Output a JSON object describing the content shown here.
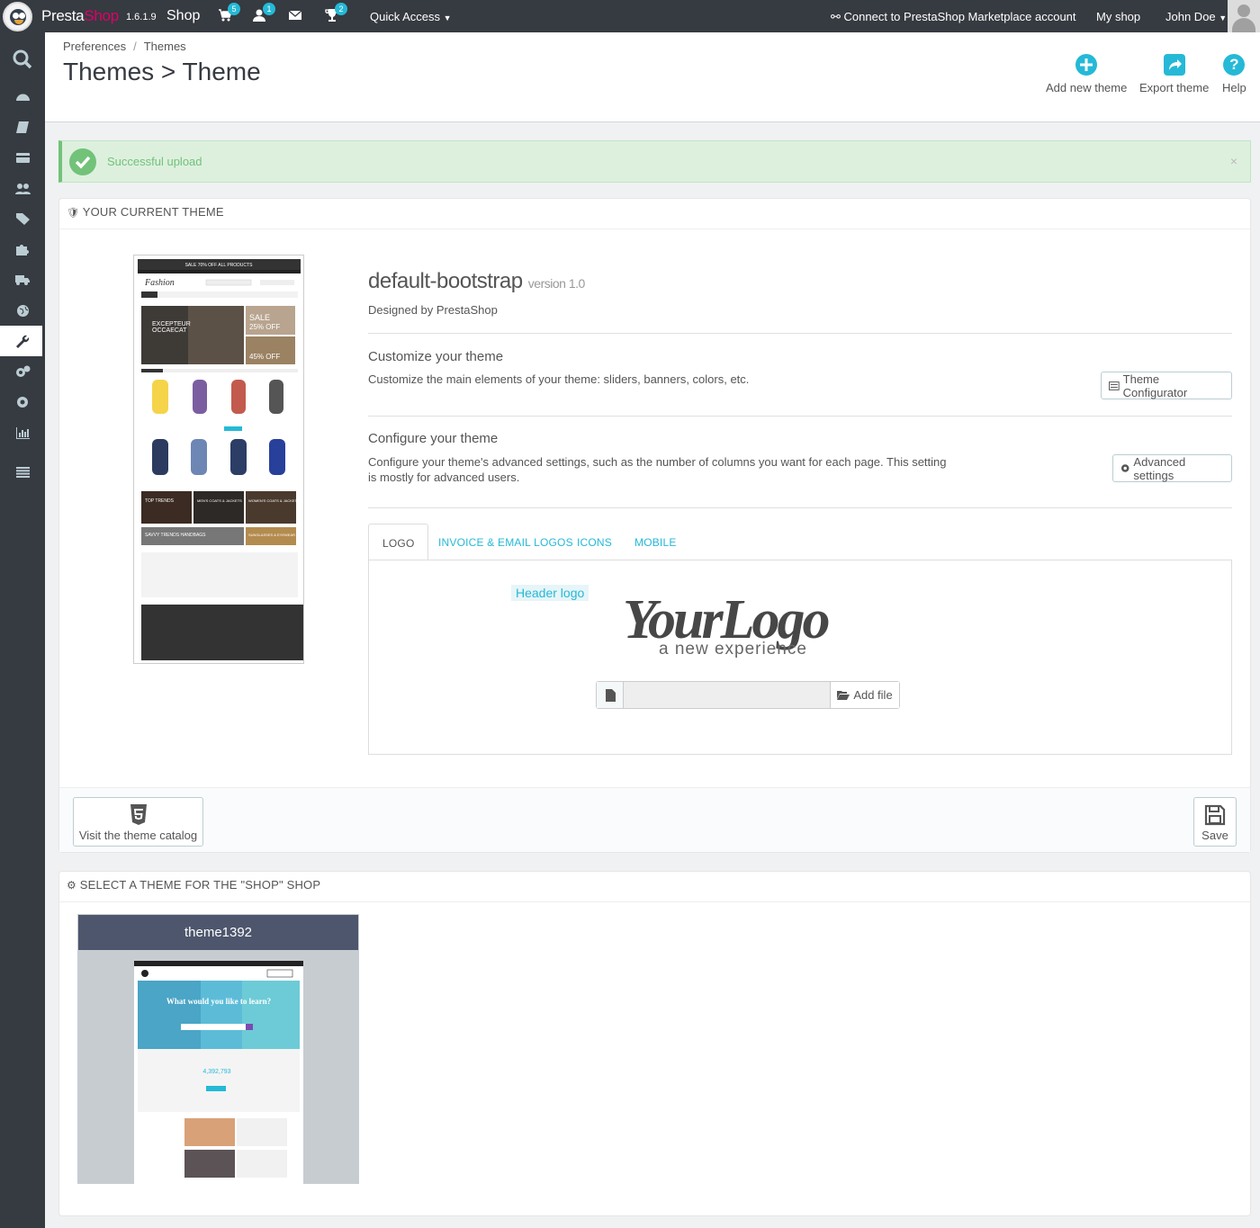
{
  "topbar": {
    "brand_1": "Presta",
    "brand_2": "Shop",
    "version": "1.6.1.9",
    "shop_name": "Shop",
    "orders_count": "5",
    "customers_count": "1",
    "messages_count": "2",
    "quick_access": "Quick Access",
    "marketplace": "Connect to PrestaShop Marketplace account",
    "my_shop": "My shop",
    "user": "John Doe"
  },
  "sidebar": {
    "items": [
      "search-icon",
      "dashboard-icon",
      "catalog-icon",
      "orders-icon",
      "customers-icon",
      "price-rules-icon",
      "modules-icon",
      "shipping-icon",
      "localization-icon",
      "preferences-icon",
      "advanced-parameters-icon",
      "administration-icon",
      "stats-icon",
      "collapse-menu-icon"
    ],
    "active": "preferences-icon"
  },
  "header": {
    "breadcrumb": [
      "Preferences",
      "Themes"
    ],
    "title": "Themes > Theme",
    "toolbar": {
      "add_theme": "Add new theme",
      "export_theme": "Export theme",
      "help": "Help"
    },
    "accent": "#25b9d7"
  },
  "alert": {
    "message": "Successful upload",
    "close": "×",
    "color": "#72c279"
  },
  "current_theme": {
    "panel_title": "YOUR CURRENT THEME",
    "name": "default-bootstrap",
    "version": "version 1.0",
    "designed_by": "Designed by PrestaShop",
    "customize": {
      "title": "Customize your theme",
      "desc": "Customize the main elements of your theme: sliders, banners, colors, etc.",
      "button": "Theme Configurator"
    },
    "configure": {
      "title": "Configure your theme",
      "desc": "Configure your theme's advanced settings, such as the number of columns you want for each page. This setting is mostly for advanced users.",
      "button": "Advanced settings"
    },
    "tabs": [
      "LOGO",
      "INVOICE & EMAIL LOGOS",
      "ICONS",
      "MOBILE"
    ],
    "active_tab": "LOGO",
    "logo": {
      "label": "Header logo",
      "logo_text_1": "YourLogo",
      "logo_text_2": "a new experience",
      "add_file": "Add file"
    },
    "thumbnail": {
      "banner": "SALE 70% OFF ALL PRODUCTS",
      "brand": "Fashion",
      "hero_1": "EXCEPTEUR",
      "hero_2": "OCCAECAT",
      "sale_1": "SALE",
      "sale_2": "25% OFF",
      "sale_3": "45% OFF",
      "block_1": "TOP TRENDS",
      "block_2": "MEN'S COATS & JACKETS",
      "block_3": "WOMEN'S COATS & JACKETS",
      "block_4": "SAVVY TRENDS HANDBAGS",
      "block_5": "SUNGLASSES & EYEWEAR"
    },
    "footer": {
      "catalog": "Visit the theme catalog",
      "save": "Save"
    }
  },
  "select_theme": {
    "panel_title": "SELECT A THEME FOR THE \"SHOP\" SHOP",
    "themes": [
      {
        "name": "theme1392",
        "preview_headline": "What would you like to learn?",
        "preview_number": "4,392,793"
      }
    ]
  }
}
